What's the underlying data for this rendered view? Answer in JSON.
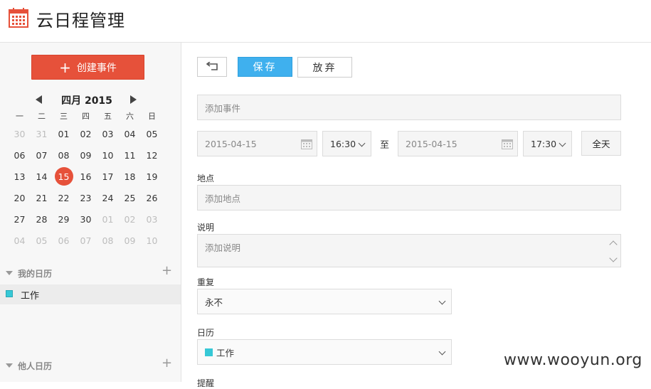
{
  "app": {
    "title": "云日程管理"
  },
  "sidebar": {
    "create_button": "创建事件",
    "calendar": {
      "month_label": "四月 2015",
      "weekdays": [
        "一",
        "二",
        "三",
        "四",
        "五",
        "六",
        "日"
      ],
      "days": [
        {
          "d": "30",
          "muted": true
        },
        {
          "d": "31",
          "muted": true
        },
        {
          "d": "01"
        },
        {
          "d": "02"
        },
        {
          "d": "03"
        },
        {
          "d": "04"
        },
        {
          "d": "05"
        },
        {
          "d": "06"
        },
        {
          "d": "07"
        },
        {
          "d": "08"
        },
        {
          "d": "09"
        },
        {
          "d": "10"
        },
        {
          "d": "11"
        },
        {
          "d": "12"
        },
        {
          "d": "13"
        },
        {
          "d": "14"
        },
        {
          "d": "15",
          "today": true
        },
        {
          "d": "16"
        },
        {
          "d": "17"
        },
        {
          "d": "18"
        },
        {
          "d": "19"
        },
        {
          "d": "20"
        },
        {
          "d": "21"
        },
        {
          "d": "22"
        },
        {
          "d": "23"
        },
        {
          "d": "24"
        },
        {
          "d": "25"
        },
        {
          "d": "26"
        },
        {
          "d": "27"
        },
        {
          "d": "28"
        },
        {
          "d": "29"
        },
        {
          "d": "30"
        },
        {
          "d": "01",
          "muted": true
        },
        {
          "d": "02",
          "muted": true
        },
        {
          "d": "03",
          "muted": true
        },
        {
          "d": "04",
          "muted": true
        },
        {
          "d": "05",
          "muted": true
        },
        {
          "d": "06",
          "muted": true
        },
        {
          "d": "07",
          "muted": true
        },
        {
          "d": "08",
          "muted": true
        },
        {
          "d": "09",
          "muted": true
        },
        {
          "d": "10",
          "muted": true
        }
      ]
    },
    "my_calendars": {
      "label": "我的日历",
      "items": [
        {
          "label": "工作",
          "color": "#36c8d6"
        }
      ]
    },
    "other_calendars": {
      "label": "他人日历"
    }
  },
  "editor": {
    "save_label": "保存",
    "discard_label": "放弃",
    "title_placeholder": "添加事件",
    "start_date": "2015-04-15",
    "start_time": "16:30",
    "to_label": "至",
    "end_date": "2015-04-15",
    "end_time": "17:30",
    "allday_label": "全天",
    "location_label": "地点",
    "location_placeholder": "添加地点",
    "description_label": "说明",
    "description_placeholder": "添加说明",
    "repeat_label": "重复",
    "repeat_value": "永不",
    "calendar_label": "日历",
    "calendar_value": "工作",
    "reminder_label": "提醒"
  },
  "watermark": "www.wooyun.org",
  "colors": {
    "accent_red": "#e6513a",
    "accent_blue": "#3fb0ee",
    "calendar_cyan": "#36c8d6"
  }
}
